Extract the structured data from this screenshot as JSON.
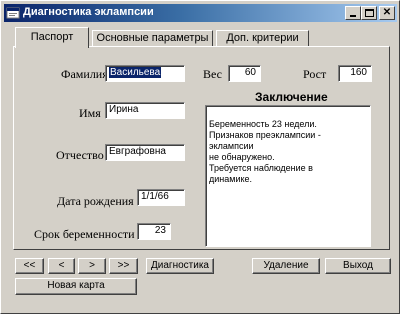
{
  "window": {
    "title": "Диагностика эклампсии",
    "controls": [
      "minimize",
      "maximize",
      "close"
    ]
  },
  "tabs": [
    {
      "label": "Паспорт",
      "active": true
    },
    {
      "label": "Основные параметры",
      "active": false
    },
    {
      "label": "Доп. критерии",
      "active": false
    }
  ],
  "form": {
    "surname_label": "Фамилия",
    "surname_value": "Васильева",
    "name_label": "Имя",
    "name_value": "Ирина",
    "patronymic_label": "Отчество",
    "patronymic_value": "Евграфовна",
    "birthdate_label": "Дата рождения",
    "birthdate_value": "1/1/66",
    "term_label": "Срок беременности",
    "term_value": "23",
    "weight_label": "Вес",
    "weight_value": "60",
    "height_label": "Рост",
    "height_value": "160"
  },
  "conclusion": {
    "title": "Заключение",
    "lines": [
      "Беременность 23 недели.",
      "Признаков преэклампсии -",
      "эклампсии",
      "не обнаружено.",
      "Требуется наблюдение в",
      "динамике."
    ]
  },
  "buttons": {
    "first": "<<",
    "prev": "<",
    "next": ">",
    "last": ">>",
    "diagnostics": "Диагностика",
    "delete": "Удаление",
    "exit": "Выход",
    "new_card": "Новая карта"
  },
  "colors": {
    "titlebar_start": "#0a246a",
    "titlebar_end": "#a6caf0",
    "face": "#d4d0c8",
    "selection": "#0a246a"
  }
}
